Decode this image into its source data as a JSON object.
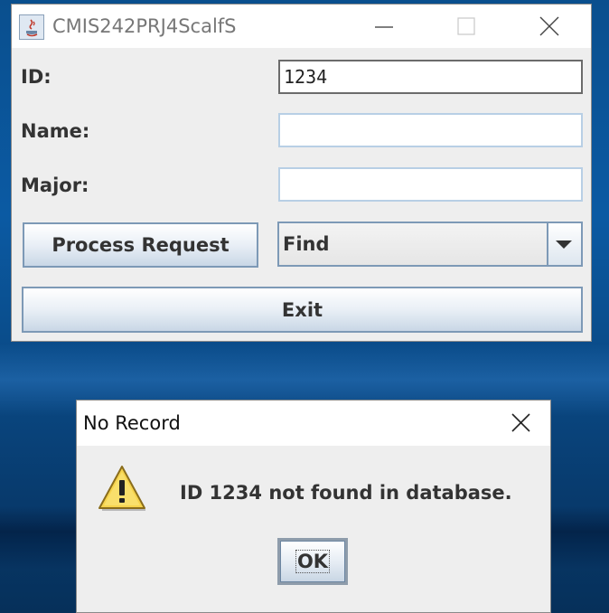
{
  "main_window": {
    "title": "CMIS242PRJ4ScalfS",
    "fields": {
      "id_label": "ID:",
      "id_value": "1234",
      "name_label": "Name:",
      "name_value": "",
      "major_label": "Major:",
      "major_value": ""
    },
    "process_button_label": "Process Request",
    "action_combo_value": "Find",
    "exit_button_label": "Exit"
  },
  "dialog": {
    "title": "No Record",
    "message": "ID 1234 not found in database.",
    "ok_label": "OK",
    "icon": "warning-icon"
  },
  "colors": {
    "desktop_bg": "#0b5aa3",
    "window_bg": "#eeeeee",
    "button_border": "#7d99b6",
    "input_border": "#b8cfe5",
    "warning_yellow": "#f6d34c"
  }
}
